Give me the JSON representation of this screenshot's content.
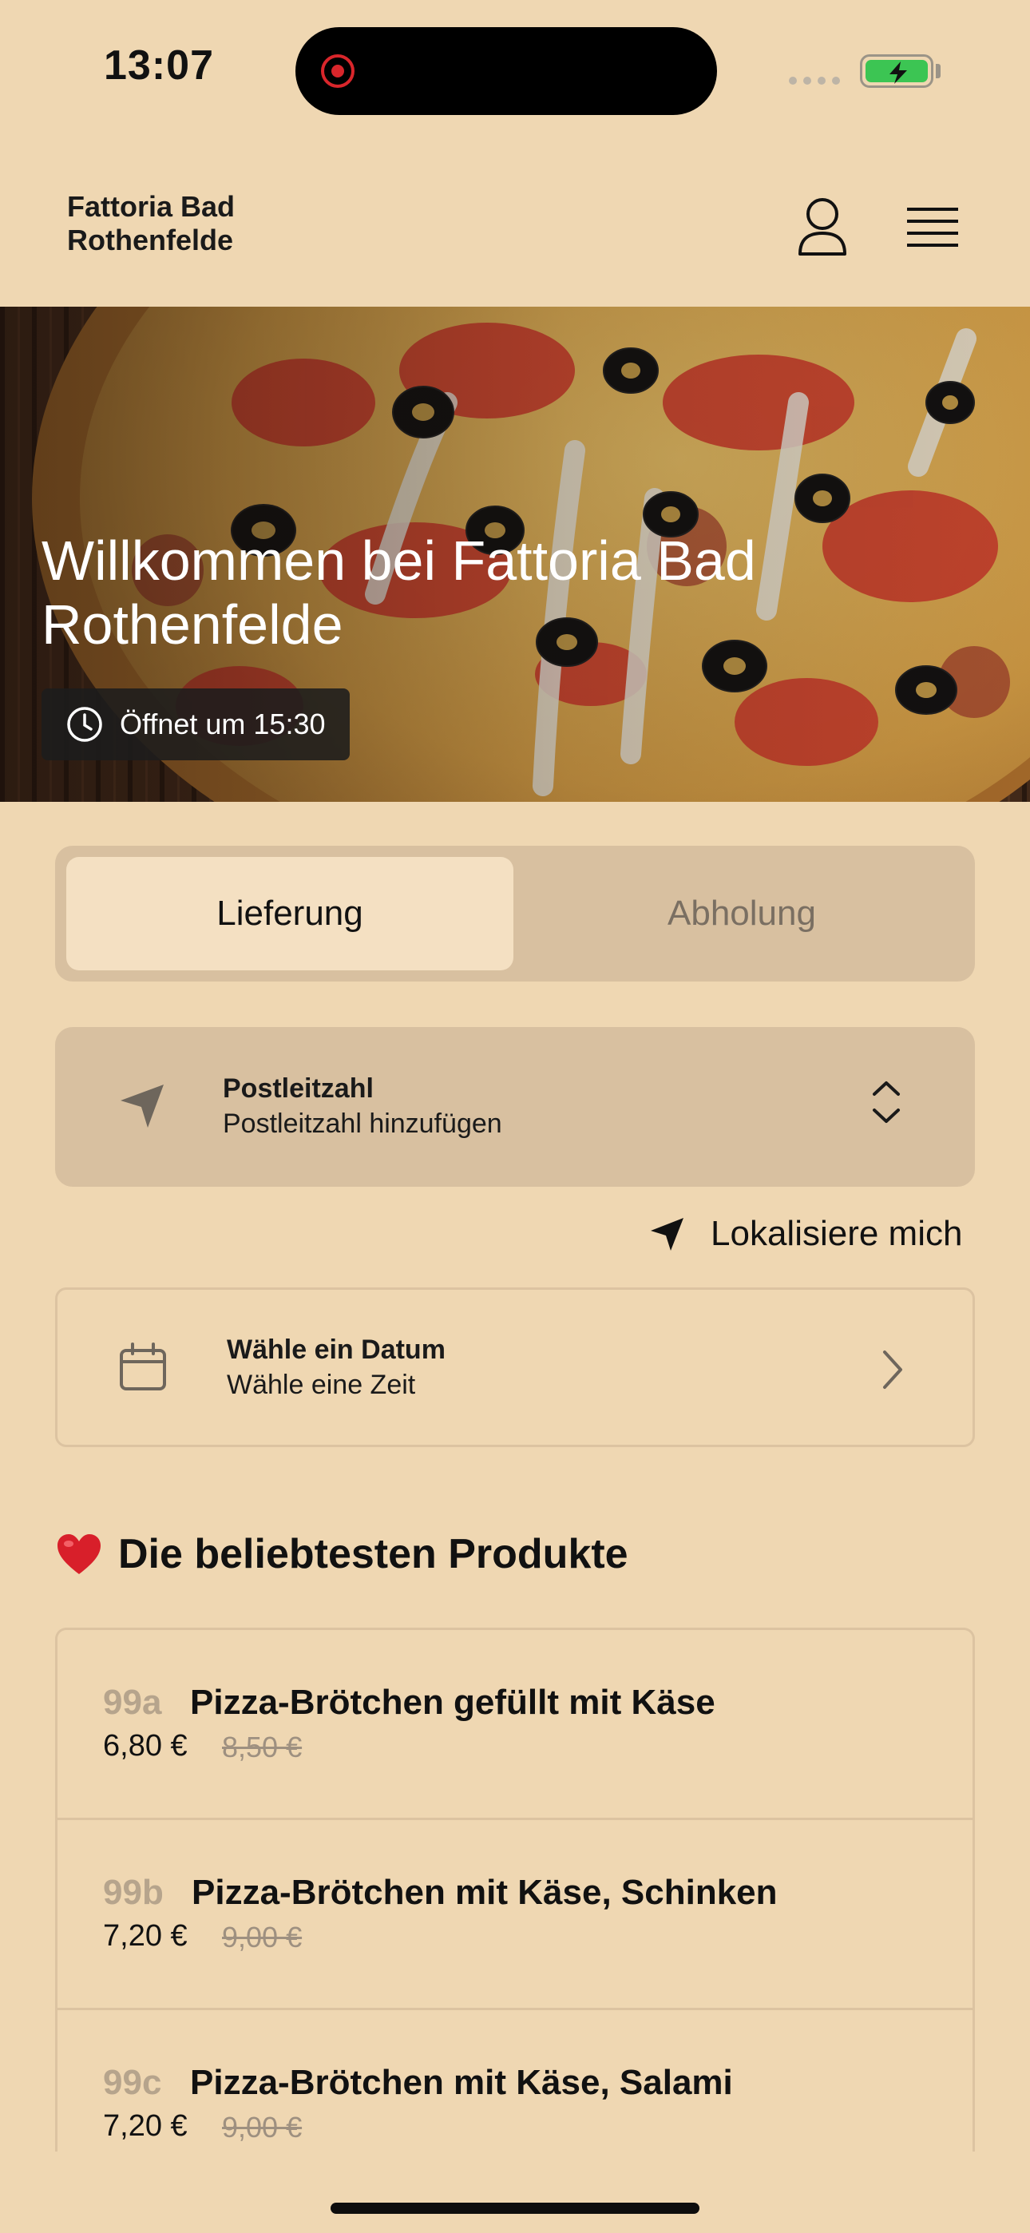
{
  "status_bar": {
    "time": "13:07"
  },
  "header": {
    "brand": "Fattoria Bad Rothenfelde",
    "account_icon": "user-icon",
    "menu_icon": "hamburger-menu-icon"
  },
  "hero": {
    "title": "Willkommen bei Fattoria Bad Rothenfelde",
    "opening_label": "Öffnet um 15:30",
    "opening_icon": "clock-icon"
  },
  "order_mode": {
    "options": [
      "Lieferung",
      "Abholung"
    ],
    "selected": "Lieferung"
  },
  "postcode": {
    "label": "Postleitzahl",
    "placeholder": "Postleitzahl hinzufügen",
    "icon": "location-arrow-icon"
  },
  "locate": {
    "label": "Lokalisiere mich"
  },
  "schedule": {
    "date_label": "Wähle ein Datum",
    "time_label": "Wähle eine Zeit",
    "icon": "calendar-icon"
  },
  "popular": {
    "title": "Die beliebtesten Produkte",
    "items": [
      {
        "number": "99a",
        "name": "Pizza-Brötchen gefüllt mit Käse",
        "price": "6,80 €",
        "old_price": "8,50 €"
      },
      {
        "number": "99b",
        "name": "Pizza-Brötchen mit Käse, Schinken",
        "price": "7,20 €",
        "old_price": "9,00 €"
      },
      {
        "number": "99c",
        "name": "Pizza-Brötchen mit Käse, Salami",
        "price": "7,20 €",
        "old_price": "9,00 €"
      }
    ]
  },
  "colors": {
    "background": "#efd7b2",
    "panel": "#d8c0a0",
    "selected_segment": "#f4e0c2",
    "battery": "#3cc553",
    "record": "#d9262b"
  }
}
